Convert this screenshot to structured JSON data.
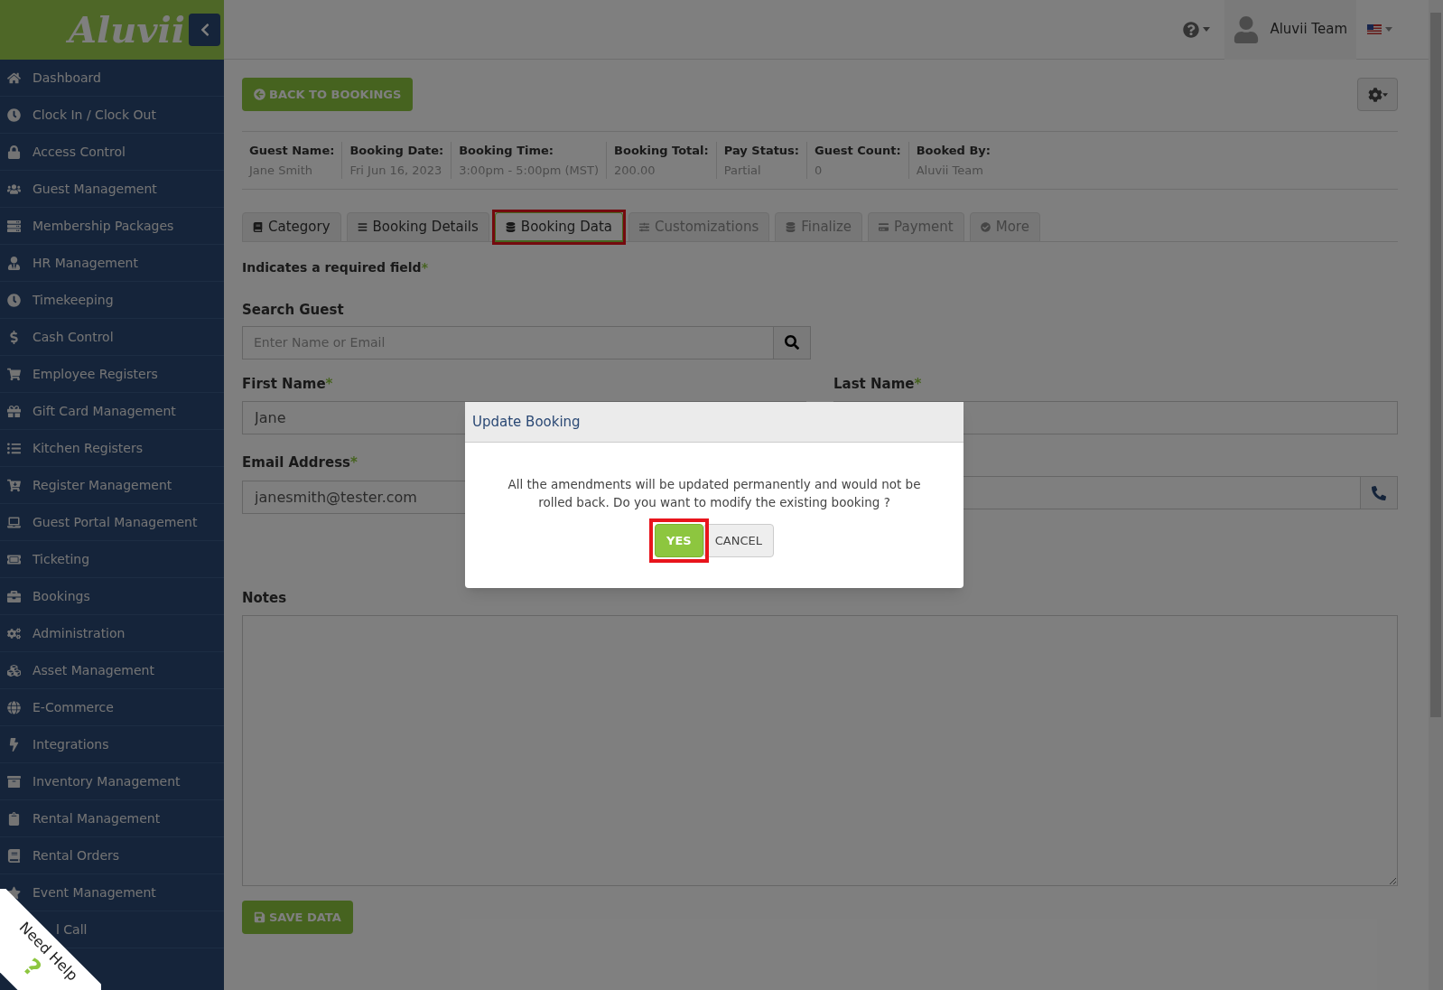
{
  "brand": {
    "logo": "Aluvii"
  },
  "sidebar": {
    "items": [
      {
        "label": "Dashboard"
      },
      {
        "label": "Clock In / Clock Out"
      },
      {
        "label": "Access Control"
      },
      {
        "label": "Guest Management"
      },
      {
        "label": "Membership Packages"
      },
      {
        "label": "HR Management"
      },
      {
        "label": "Timekeeping"
      },
      {
        "label": "Cash Control"
      },
      {
        "label": "Employee Registers"
      },
      {
        "label": "Gift Card Management"
      },
      {
        "label": "Kitchen Registers"
      },
      {
        "label": "Register Management"
      },
      {
        "label": "Guest Portal Management"
      },
      {
        "label": "Ticketing"
      },
      {
        "label": "Bookings"
      },
      {
        "label": "Administration"
      },
      {
        "label": "Asset Management"
      },
      {
        "label": "E-Commerce"
      },
      {
        "label": "Integrations"
      },
      {
        "label": "Inventory Management"
      },
      {
        "label": "Rental Management"
      },
      {
        "label": "Rental Orders"
      },
      {
        "label": "Event Management"
      },
      {
        "label": "l Call"
      }
    ]
  },
  "help_ribbon": {
    "label": "Need Help",
    "mark": "?"
  },
  "topbar": {
    "user": "Aluvii Team"
  },
  "back_button": "BACK TO BOOKINGS",
  "summary": [
    {
      "label": "Guest Name:",
      "value": "Jane Smith"
    },
    {
      "label": "Booking Date:",
      "value": "Fri Jun 16, 2023"
    },
    {
      "label": "Booking Time:",
      "value": "3:00pm - 5:00pm (MST)"
    },
    {
      "label": "Booking Total:",
      "value": "200.00"
    },
    {
      "label": "Pay Status:",
      "value": "Partial"
    },
    {
      "label": "Guest Count:",
      "value": "0"
    },
    {
      "label": "Booked By:",
      "value": "Aluvii Team"
    }
  ],
  "tabs": [
    {
      "label": "Category",
      "selected": false,
      "disabled": false,
      "highlighted": false
    },
    {
      "label": "Booking Details",
      "selected": false,
      "disabled": false,
      "highlighted": false
    },
    {
      "label": "Booking Data",
      "selected": true,
      "disabled": false,
      "highlighted": true
    },
    {
      "label": "Customizations",
      "selected": false,
      "disabled": true,
      "highlighted": false
    },
    {
      "label": "Finalize",
      "selected": false,
      "disabled": true,
      "highlighted": false
    },
    {
      "label": "Payment",
      "selected": false,
      "disabled": true,
      "highlighted": false
    },
    {
      "label": "More",
      "selected": false,
      "disabled": true,
      "highlighted": false
    }
  ],
  "required_note": {
    "text": "Indicates a required field",
    "mark": "*"
  },
  "search": {
    "label": "Search Guest",
    "placeholder": "Enter Name or Email"
  },
  "first_name": {
    "label": "First Name",
    "mark": "*",
    "value": "Jane"
  },
  "last_name": {
    "label": "Last Name",
    "mark": "*"
  },
  "email": {
    "label": "Email Address",
    "mark": "*",
    "value": "janesmith@tester.com"
  },
  "notes": {
    "label": "Notes"
  },
  "save_button": "SAVE DATA",
  "dialog": {
    "title": "Update Booking",
    "message": "All the amendments will be updated permanently and would not be rolled back. Do you want to modify the existing booking ?",
    "buttons": [
      {
        "label": "YES",
        "kind": "primary",
        "highlighted": true
      },
      {
        "label": "CANCEL",
        "kind": "default",
        "highlighted": false
      }
    ]
  }
}
